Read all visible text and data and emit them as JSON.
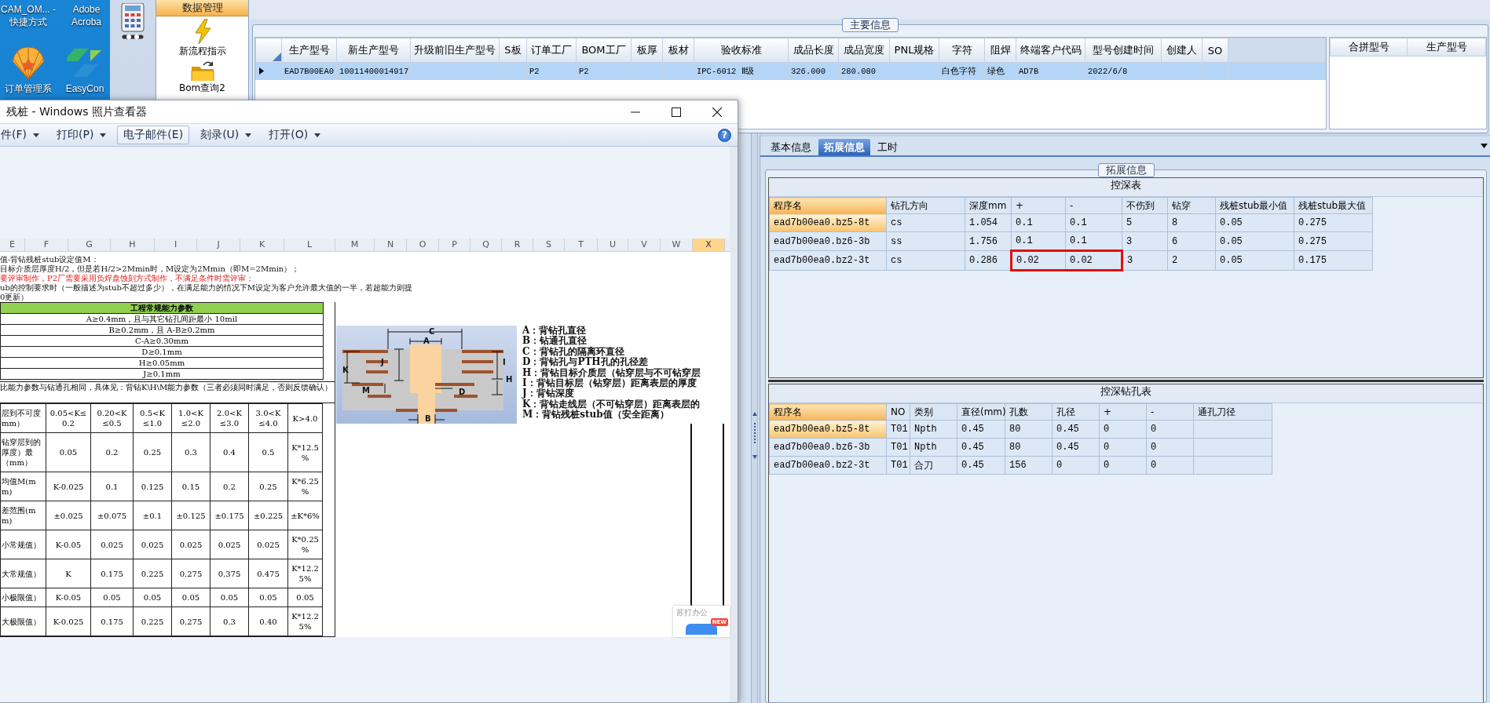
{
  "desktop": {
    "icons": [
      {
        "label": "CAM_OM... - 快捷方式"
      },
      {
        "label": "Adobe Acroba"
      },
      {
        "label": "订单管理系",
        "kind": "shell"
      },
      {
        "label": "EasyCon",
        "kind": "arrows"
      }
    ]
  },
  "app": {
    "nav": {
      "header": "数据管理",
      "items": [
        {
          "label": "新流程指示",
          "kind": "lightning"
        },
        {
          "label": "Bom查询2",
          "kind": "folder"
        }
      ]
    },
    "main_info": {
      "title": "主要信息",
      "table": {
        "columns": [
          "生产型号",
          "新生产型号",
          "升级前旧生产型号",
          "S板",
          "订单工厂",
          "BOM工厂",
          "板厚",
          "板材",
          "验收标准",
          "成品长度",
          "成品宽度",
          "PNL规格",
          "字符",
          "阻焊",
          "终端客户代码",
          "型号创建时间",
          "创建人",
          "SO"
        ],
        "rows": [
          {
            "selected": true,
            "cells": [
              "EAD7B00EA0",
              "10011400014917",
              null,
              null,
              "P2",
              "P2",
              null,
              null,
              "IPC-6012 Ⅱ级",
              "326.000",
              "280.080",
              null,
              "白色字符",
              "绿色",
              "AD7B",
              "2022/6/8",
              null,
              null
            ]
          }
        ]
      },
      "merge_table": {
        "columns": [
          "合拼型号",
          "生产型号"
        ]
      }
    },
    "detail": {
      "tabs": [
        {
          "label": "基本信息",
          "selected": false
        },
        {
          "label": "拓展信息",
          "selected": true
        },
        {
          "label": "工时",
          "selected": false
        }
      ],
      "group_title": "拓展信息",
      "depth_table": {
        "caption": "控深表",
        "columns": [
          "程序名",
          "钻孔方向",
          "深度mm",
          "+",
          "-",
          "不伤到",
          "钻穿",
          "残桩stub最小值",
          "残桩stub最大值"
        ],
        "rows": [
          {
            "selected": true,
            "cells": [
              "ead7b00ea0.bz5-8t",
              "cs",
              "1.054",
              "0.1",
              "0.1",
              "5",
              "8",
              "0.05",
              "0.275"
            ]
          },
          {
            "selected": false,
            "cells": [
              "ead7b00ea0.bz6-3b",
              "ss",
              "1.756",
              "0.1",
              "0.1",
              "3",
              "6",
              "0.05",
              "0.275"
            ]
          },
          {
            "selected": false,
            "cells": [
              "ead7b00ea0.bz2-3t",
              "cs",
              "0.286",
              {
                "text": "0.02",
                "boxed": true
              },
              {
                "text": "0.02",
                "boxed": true
              },
              "3",
              "2",
              "0.05",
              "0.175"
            ]
          }
        ]
      },
      "drill_table": {
        "caption": "控深钻孔表",
        "columns": [
          "程序名",
          "NO",
          "类别",
          "直径(mm)",
          "孔数",
          "孔径",
          "+",
          "-",
          "通孔刀径"
        ],
        "rows": [
          {
            "selected": true,
            "cells": [
              "ead7b00ea0.bz5-8t",
              "T01",
              "Npth",
              "0.45",
              "80",
              "0.45",
              "0",
              "0",
              null
            ]
          },
          {
            "selected": false,
            "cells": [
              "ead7b00ea0.bz6-3b",
              "T01",
              "Npth",
              "0.45",
              "80",
              "0.45",
              "0",
              "0",
              null
            ]
          },
          {
            "selected": false,
            "cells": [
              "ead7b00ea0.bz2-3t",
              "T01",
              "合刀",
              "0.45",
              "156",
              "0",
              "0",
              "0",
              null
            ]
          }
        ]
      }
    }
  },
  "photo_viewer": {
    "title": "残桩 - Windows 照片查看器",
    "menu": [
      {
        "label": "件(F)",
        "dropdown": true
      },
      {
        "label": "打印(P)",
        "dropdown": true
      },
      {
        "label": "电子邮件(E)",
        "dropdown": false
      },
      {
        "label": "刻录(U)",
        "dropdown": true
      },
      {
        "label": "打开(O)",
        "dropdown": true
      }
    ],
    "help": "?",
    "document": {
      "columns": [
        {
          "label": "E",
          "selected": false
        },
        {
          "label": "F",
          "selected": false
        },
        {
          "label": "G",
          "selected": false
        },
        {
          "label": "H",
          "selected": false
        },
        {
          "label": "I",
          "selected": false
        },
        {
          "label": "J",
          "selected": false
        },
        {
          "label": "K",
          "selected": false
        },
        {
          "label": "L",
          "selected": false
        },
        {
          "label": "M",
          "selected": false
        },
        {
          "label": "N",
          "selected": false
        },
        {
          "label": "O",
          "selected": false
        },
        {
          "label": "P",
          "selected": false
        },
        {
          "label": "Q",
          "selected": false
        },
        {
          "label": "R",
          "selected": false
        },
        {
          "label": "S",
          "selected": false
        },
        {
          "label": "T",
          "selected": false
        },
        {
          "label": "U",
          "selected": false
        },
        {
          "label": "V",
          "selected": false
        },
        {
          "label": "W",
          "selected": false
        },
        {
          "label": "X",
          "selected": true
        }
      ],
      "notes": [
        {
          "kind": "plain",
          "text": "值-背钻残桩stub设定值M："
        },
        {
          "kind": "plain",
          "text": "目标介质层厚度H/2，但是若H/2>2Mmin时，M设定为2Mmin（即M=2Mmin）；"
        },
        {
          "kind": "warning",
          "text": "要评审制作，P2厂需要采用负焊盘蚀刻方式制作，不满足条件时需评审；"
        },
        {
          "kind": "plain",
          "text": "ub的控制要求时（一般描述为stub不超过多少），在满足能力的情况下M设定为客户允许最大值的一半，若超能力则提"
        },
        {
          "kind": "plain",
          "text": "0更新）"
        }
      ],
      "param_table": {
        "title": "工程常规能力参数",
        "rows": [
          "A≥0.4mm，且与其它钻孔间距最小 10mil",
          "B≥0.2mm，且 A-B≥0.2mm",
          "C-A≥0.30mm",
          "D≥0.1mm",
          "H≥0.05mm",
          "J≥0.1mm"
        ]
      },
      "note2": "比能力参数与钻通孔相同，具体见：背钻K\\H\\M能力参数（三者必须同时满足，否则反馈确认）",
      "stub_table": {
        "rows": [
          [
            "层到不可度mm）",
            "0.05<K≤\n0.2",
            "0.20<K\n≤0.5",
            "0.5<K\n≤1.0",
            "1.0<K\n≤2.0",
            "2.0<K\n≤3.0",
            "3.0<K\n≤4.0",
            "K>4.0"
          ],
          [
            "钻穿层到的厚度）最（mm）",
            "0.05",
            "0.2",
            "0.25",
            "0.3",
            "0.4",
            "0.5",
            "K*12.5\n%"
          ],
          [
            "均值M(mm)",
            "K-0.025",
            "0.1",
            "0.125",
            "0.15",
            "0.2",
            "0.25",
            "K*6.25\n%"
          ],
          [
            "差范围(mm)",
            "±0.025",
            "±0.075",
            "±0.1",
            "±0.125",
            "±0.175",
            "±0.225",
            "±K*6%"
          ],
          [
            "小常规值）",
            "K-0.05",
            "0.025",
            "0.025",
            "0.025",
            "0.025",
            "0.025",
            "K*0.25\n%"
          ],
          [
            "大常规值）",
            "K",
            "0.175",
            "0.225",
            "0.275",
            "0.375",
            "0.475",
            "K*12.2\n5%"
          ],
          [
            "小极限值）",
            "K-0.05",
            "0.05",
            "0.05",
            "0.05",
            "0.05",
            "0.05",
            "0.05"
          ],
          [
            "大极限值）",
            "K-0.025",
            "0.175",
            "0.225",
            "0.275",
            "0.3",
            "0.40",
            "K*12.2\n5%"
          ]
        ]
      },
      "diagram_labels": [
        "C",
        "A",
        "K",
        "J",
        "I",
        "H",
        "M",
        "D",
        "B"
      ],
      "legend": [
        "A：背钻孔直径",
        "B：钻通孔直径",
        "C：背钻孔的隔离环直径",
        "D：背钻孔与PTH孔的孔径差",
        "H：背钻目标介质层（钻穿层与不可钻穿层",
        "I：背钻目标层（钻穿层）距离表层的厚度",
        "J：背钻深度",
        "K：背钻走线层（不可钻穿层）距离表层的",
        "M：背钻残桩stub值（安全距离）"
      ],
      "popup": {
        "text": "苏打办公",
        "badge": "NEW"
      }
    }
  }
}
